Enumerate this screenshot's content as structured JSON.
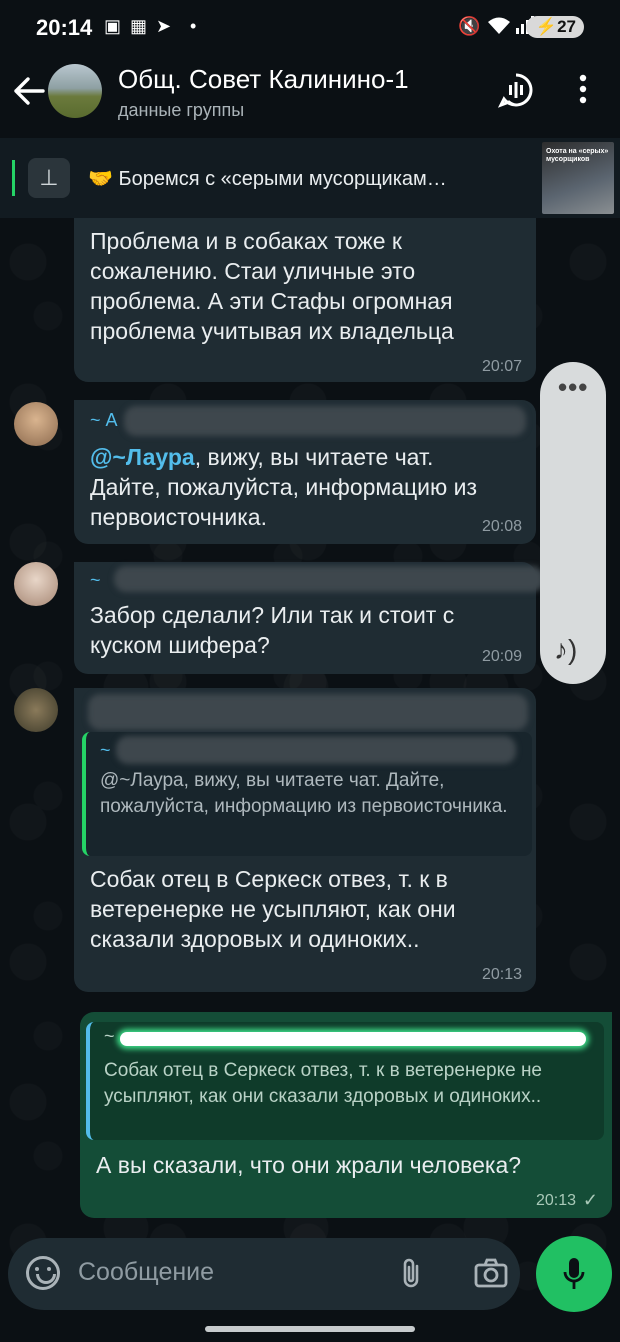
{
  "status_bar": {
    "time": "20:14",
    "battery": "27"
  },
  "header": {
    "title": "Общ. Совет Калинино-1",
    "subtitle": "данные группы"
  },
  "pinned": {
    "text": "🤝 Боремся с «серыми мусорщикам…",
    "thumb_text": "Охота на «серых» мусорщиков"
  },
  "messages": [
    {
      "text": "Проблема и в собаках тоже к сожалению. Стаи уличные это проблема. А эти Стафы огромная проблема учитывая их владельца",
      "time": "20:07"
    },
    {
      "sender_fragment": "~ А",
      "mention": "@~Лаура",
      "text": ", вижу, вы читаете чат. Дайте, пожалуйста, информацию из первоисточника.",
      "time": "20:08"
    },
    {
      "sender_fragment": "~",
      "text": "Забор сделали? Или так и стоит с куском шифера?",
      "time": "20:09"
    },
    {
      "quote_sender": "~",
      "quote_text": "@~Лаура, вижу, вы читаете чат. Дайте, пожалуйста, информацию из первоисточника.",
      "text": "Собак отец в Серкеск отвез, т. к в ветеренерке не усыпляют, как они сказали здоровых и одиноких..",
      "time": "20:13"
    },
    {
      "quote_sender": "~",
      "quote_text": "Собак отец в Серкеск отвез, т. к в ветеренерке не усыпляют, как они сказали здоровых и одиноких..",
      "text": "А вы сказали, что они жрали человека?",
      "time": "20:13",
      "status": "✓"
    }
  ],
  "input": {
    "placeholder": "Сообщение"
  },
  "colors": {
    "accent": "#21c063",
    "outgoing": "#144d37",
    "incoming": "#1f2c33",
    "link": "#53bdeb"
  }
}
